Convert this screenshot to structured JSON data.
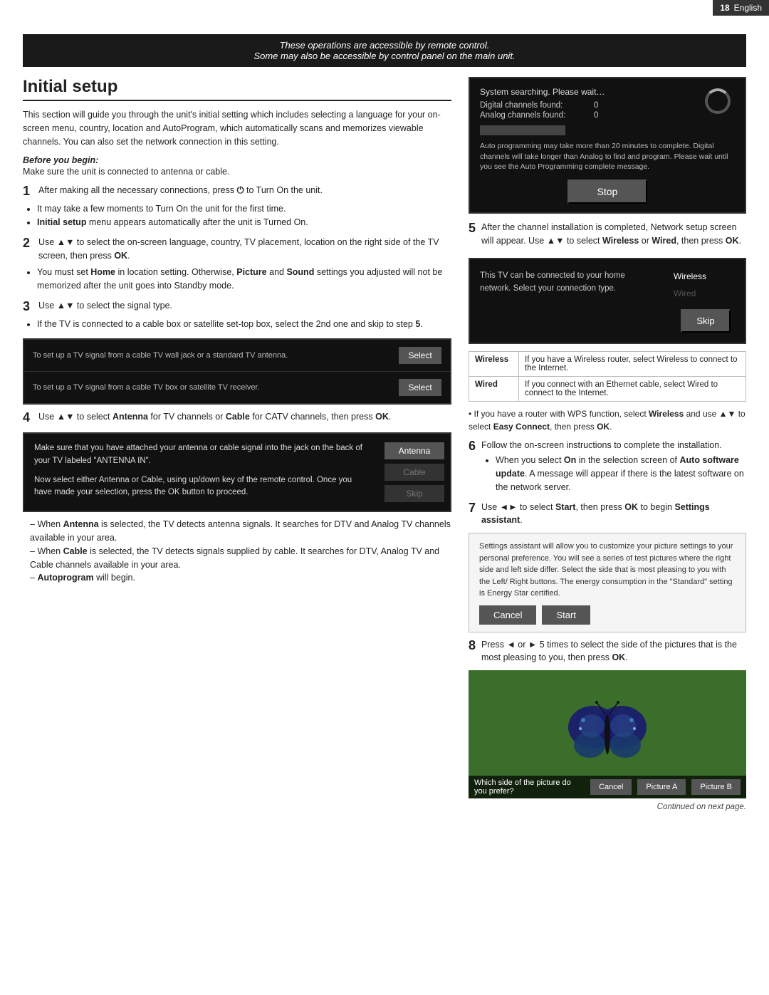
{
  "header": {
    "page_number": "18",
    "language": "English"
  },
  "remote_notice": {
    "line1": "These operations are accessible by remote control.",
    "line2": "Some may also be accessible by control panel on the main unit."
  },
  "page_title": "Initial setup",
  "intro": "This section will guide you through the unit's initial setting which includes selecting a language for your on-screen menu, country, location and AutoProgram, which automatically scans and memorizes viewable channels. You can also set the network connection in this setting.",
  "before_begin": {
    "label": "Before you begin:",
    "text": "Make sure the unit is connected to antenna or cable."
  },
  "steps": [
    {
      "num": "1",
      "text": "After making all the necessary connections, press",
      "symbol": "⏻",
      "text2": "to Turn On the unit.",
      "bullets": [
        "It may take a few moments to Turn On the unit for the first time.",
        "Initial setup menu appears automatically after the unit is Turned On."
      ]
    },
    {
      "num": "2",
      "text": "Use ▲▼ to select the on-screen language, country, TV placement, location on the right side of the TV screen, then press OK.",
      "bullets": [
        "You must set Home in location setting. Otherwise, Picture and Sound settings you adjusted will not be memorized after the unit goes into Standby mode."
      ]
    },
    {
      "num": "3",
      "text": "Use ▲▼ to select the signal type.",
      "bullets": [
        "If the TV is connected to a cable box or satellite set-top box, select the 2nd one and skip to step 5."
      ]
    }
  ],
  "signal_screen": {
    "row1_text": "To set up a TV signal from a cable TV wall jack or a standard TV antenna.",
    "row1_btn": "Select",
    "row2_text": "To set up a TV signal from a cable TV box or satellite TV receiver.",
    "row2_btn": "Select"
  },
  "step4": {
    "num": "4",
    "text": "Use ▲▼ to select Antenna for TV channels or Cable for CATV channels, then press OK.",
    "screen_left1": "Make sure that you have attached your antenna or cable signal into the jack on the back of your TV labeled \"ANTENNA IN\".",
    "screen_left2": "Now select either Antenna or Cable, using up/down key of the remote control. Once you have made your selection, press the OK button to proceed.",
    "options": [
      "Antenna",
      "Cable",
      "Skip"
    ]
  },
  "dash_items": [
    "When Antenna is selected, the TV detects antenna signals. It searches for DTV and Analog TV channels available in your area.",
    "When Cable is selected, the TV detects signals supplied by cable. It searches for DTV, Analog TV and Cable channels available in your area.",
    "Autoprogram will begin."
  ],
  "scan_screen": {
    "title": "System searching. Please wait…",
    "digital_label": "Digital channels found:",
    "digital_val": "0",
    "analog_label": "Analog channels found:",
    "analog_val": "0",
    "desc": "Auto programming may take more than 20 minutes to complete. Digital channels will take longer than Analog to find and program. Please wait until you see the Auto Programming complete message.",
    "stop_btn": "Stop"
  },
  "step5": {
    "num": "5",
    "text": "After the channel installation is completed, Network setup screen will appear. Use ▲▼ to select Wireless or Wired, then press OK."
  },
  "network_screen": {
    "left_text": "This TV can be connected to your home network. Select your connection type.",
    "option1": "Wireless",
    "option2": "Wired",
    "skip_btn": "Skip"
  },
  "ww_table": [
    {
      "label": "Wireless",
      "desc": "If you have a Wireless router, select Wireless to connect to the Internet."
    },
    {
      "label": "Wired",
      "desc": "If you connect with an Ethernet cable, select Wired to connect to the Internet."
    }
  ],
  "wps_note": "If you have a router with WPS function, select Wireless and use ▲▼ to select Easy Connect, then press OK.",
  "step6": {
    "num": "6",
    "text": "Follow the on-screen instructions to complete the installation.",
    "bullets": [
      "When you select On in the selection screen of Auto software update. A message will appear if there is the latest software on the network server."
    ]
  },
  "step7": {
    "num": "7",
    "text": "Use ◄► to select Start, then press OK to begin Settings assistant."
  },
  "settings_screen": {
    "desc": "Settings assistant will allow you to customize your picture settings to your personal preference. You will see a series of test pictures where the right side and left side differ. Select the side that is most pleasing to you with the Left/ Right buttons. The energy consumption in the \"Standard\" setting is Energy Star certified.",
    "cancel_btn": "Cancel",
    "start_btn": "Start"
  },
  "step8": {
    "num": "8",
    "text": "Press ◄ or ► 5 times to select the side of the pictures that is the most pleasing to you, then press OK."
  },
  "picture_bar": {
    "question": "Which side of the picture do you prefer?",
    "cancel_btn": "Cancel",
    "picture_a_btn": "Picture A",
    "picture_b_btn": "Picture B"
  },
  "continued": "Continued on next page."
}
